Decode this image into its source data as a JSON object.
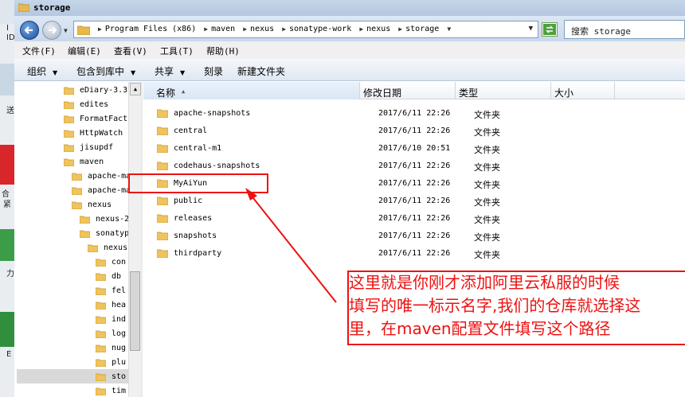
{
  "window": {
    "title": "storage"
  },
  "desktop_fragments": [
    "I",
    "ID",
    "送",
    "合",
    "紧",
    "力",
    "E"
  ],
  "address": {
    "crumbs": [
      "Program Files (x86)",
      "maven",
      "nexus",
      "sonatype-work",
      "nexus",
      "storage"
    ],
    "search_placeholder": "搜索 storage"
  },
  "menu": [
    "文件(F)",
    "编辑(E)",
    "查看(V)",
    "工具(T)",
    "帮助(H)"
  ],
  "toolbar": [
    {
      "label": "组织",
      "dropdown": true
    },
    {
      "label": "包含到库中",
      "dropdown": true
    },
    {
      "label": "共享",
      "dropdown": true
    },
    {
      "label": "刻录",
      "dropdown": false
    },
    {
      "label": "新建文件夹",
      "dropdown": false
    }
  ],
  "tree": [
    "eDiary-3.3",
    "edites",
    "FormatFact",
    "HttpWatch",
    "jisupdf",
    "maven",
    "apache-ma",
    "apache-ma",
    "nexus",
    "nexus-2",
    "sonatyp",
    "nexus",
    "con",
    "db",
    "fel",
    "hea",
    "ind",
    "log",
    "nug",
    "plu",
    "sto",
    "tim"
  ],
  "columns": {
    "name": "名称",
    "date": "修改日期",
    "type": "类型",
    "size": "大小"
  },
  "files": [
    {
      "name": "apache-snapshots",
      "date": "2017/6/11 22:26",
      "type": "文件夹"
    },
    {
      "name": "central",
      "date": "2017/6/11 22:26",
      "type": "文件夹"
    },
    {
      "name": "central-m1",
      "date": "2017/6/10 20:51",
      "type": "文件夹"
    },
    {
      "name": "codehaus-snapshots",
      "date": "2017/6/11 22:26",
      "type": "文件夹"
    },
    {
      "name": "MyAiYun",
      "date": "2017/6/11 22:26",
      "type": "文件夹"
    },
    {
      "name": "public",
      "date": "2017/6/11 22:26",
      "type": "文件夹"
    },
    {
      "name": "releases",
      "date": "2017/6/11 22:26",
      "type": "文件夹"
    },
    {
      "name": "snapshots",
      "date": "2017/6/11 22:26",
      "type": "文件夹"
    },
    {
      "name": "thirdparty",
      "date": "2017/6/11 22:26",
      "type": "文件夹"
    }
  ],
  "annotation": {
    "lines": [
      "这里就是你刚才添加阿里云私服的时候",
      "填写的唯一标示名字,我们的仓库就选择这",
      "里，在maven配置文件填写这个路径"
    ],
    "color": "#ee1111"
  }
}
